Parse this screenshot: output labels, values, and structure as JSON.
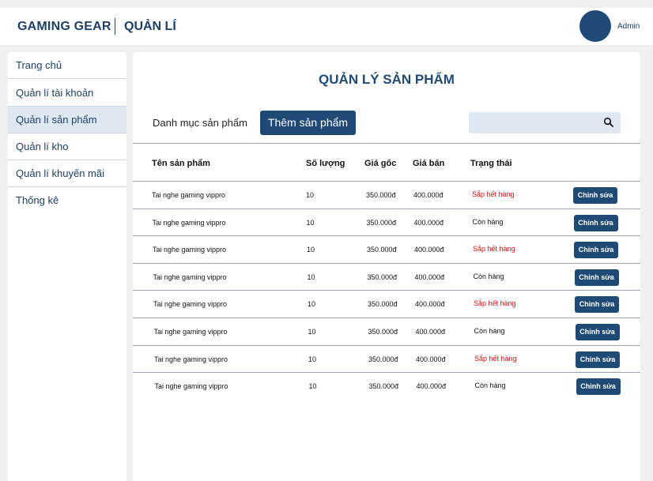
{
  "header": {
    "brand": "GAMING GEAR",
    "section": "QUẢN LÍ",
    "user": "Admin"
  },
  "sidebar": {
    "items": [
      {
        "label": "Trang chủ"
      },
      {
        "label": "Quản lí tài khoản"
      },
      {
        "label": "Quản lí sản phẩm",
        "active": true
      },
      {
        "label": "Quản lí kho"
      },
      {
        "label": "Quản lí khuyến mãi"
      },
      {
        "label": "Thống kê"
      }
    ]
  },
  "main": {
    "title": "QUẢN LÝ SẢN PHẨM",
    "category_label": "Danh mục sản phẩm",
    "add_button": "Thêm sản phẩm",
    "search": {
      "placeholder": "",
      "icon": "search-icon"
    }
  },
  "table": {
    "headers": [
      "Tên sản phẩm",
      "Số lượng",
      "Giá gốc",
      "Giá bán",
      "Trạng thái"
    ],
    "rows": [
      {
        "name": "Tai nghe gaming vippro",
        "qty": "10",
        "cost": "350.000đ",
        "price": "400.000đ",
        "status": "Sắp hết hàng",
        "low": true,
        "action": "Chỉnh sửa"
      },
      {
        "name": "Tai nghe gaming vippro",
        "qty": "10",
        "cost": "350.000đ",
        "price": "400.000đ",
        "status": "Còn hàng",
        "low": false,
        "action": "Chỉnh sửa"
      },
      {
        "name": "Tai nghe gaming vippro",
        "qty": "10",
        "cost": "350.000đ",
        "price": "400.000đ",
        "status": "Sắp hết hàng",
        "low": true,
        "action": "Chỉnh sửa"
      },
      {
        "name": "Tai nghe gaming vippro",
        "qty": "10",
        "cost": "350.000đ",
        "price": "400.000đ",
        "status": "Còn hàng",
        "low": false,
        "action": "Chỉnh sửa"
      },
      {
        "name": "Tai nghe gaming vippro",
        "qty": "10",
        "cost": "350.000đ",
        "price": "400.000đ",
        "status": "Sắp hết hàng",
        "low": true,
        "action": "Chỉnh sửa"
      },
      {
        "name": "Tai nghe gaming vippro",
        "qty": "10",
        "cost": "350.000đ",
        "price": "400.000đ",
        "status": "Còn hàng",
        "low": false,
        "action": "Chỉnh sửa"
      },
      {
        "name": "Tai nghe gaming vippro",
        "qty": "10",
        "cost": "350.000đ",
        "price": "400.000đ",
        "status": "Sắp hết hàng",
        "low": true,
        "action": "Chỉnh sửa"
      },
      {
        "name": "Tai nghe gaming vippro",
        "qty": "10",
        "cost": "350.000đ",
        "price": "400.000đ",
        "status": "Còn hàng",
        "low": false,
        "action": "Chỉnh sửa"
      }
    ]
  },
  "colors": {
    "primary": "#1e4a75",
    "active_bg": "#dde8f3",
    "status_low": "#e01010"
  }
}
